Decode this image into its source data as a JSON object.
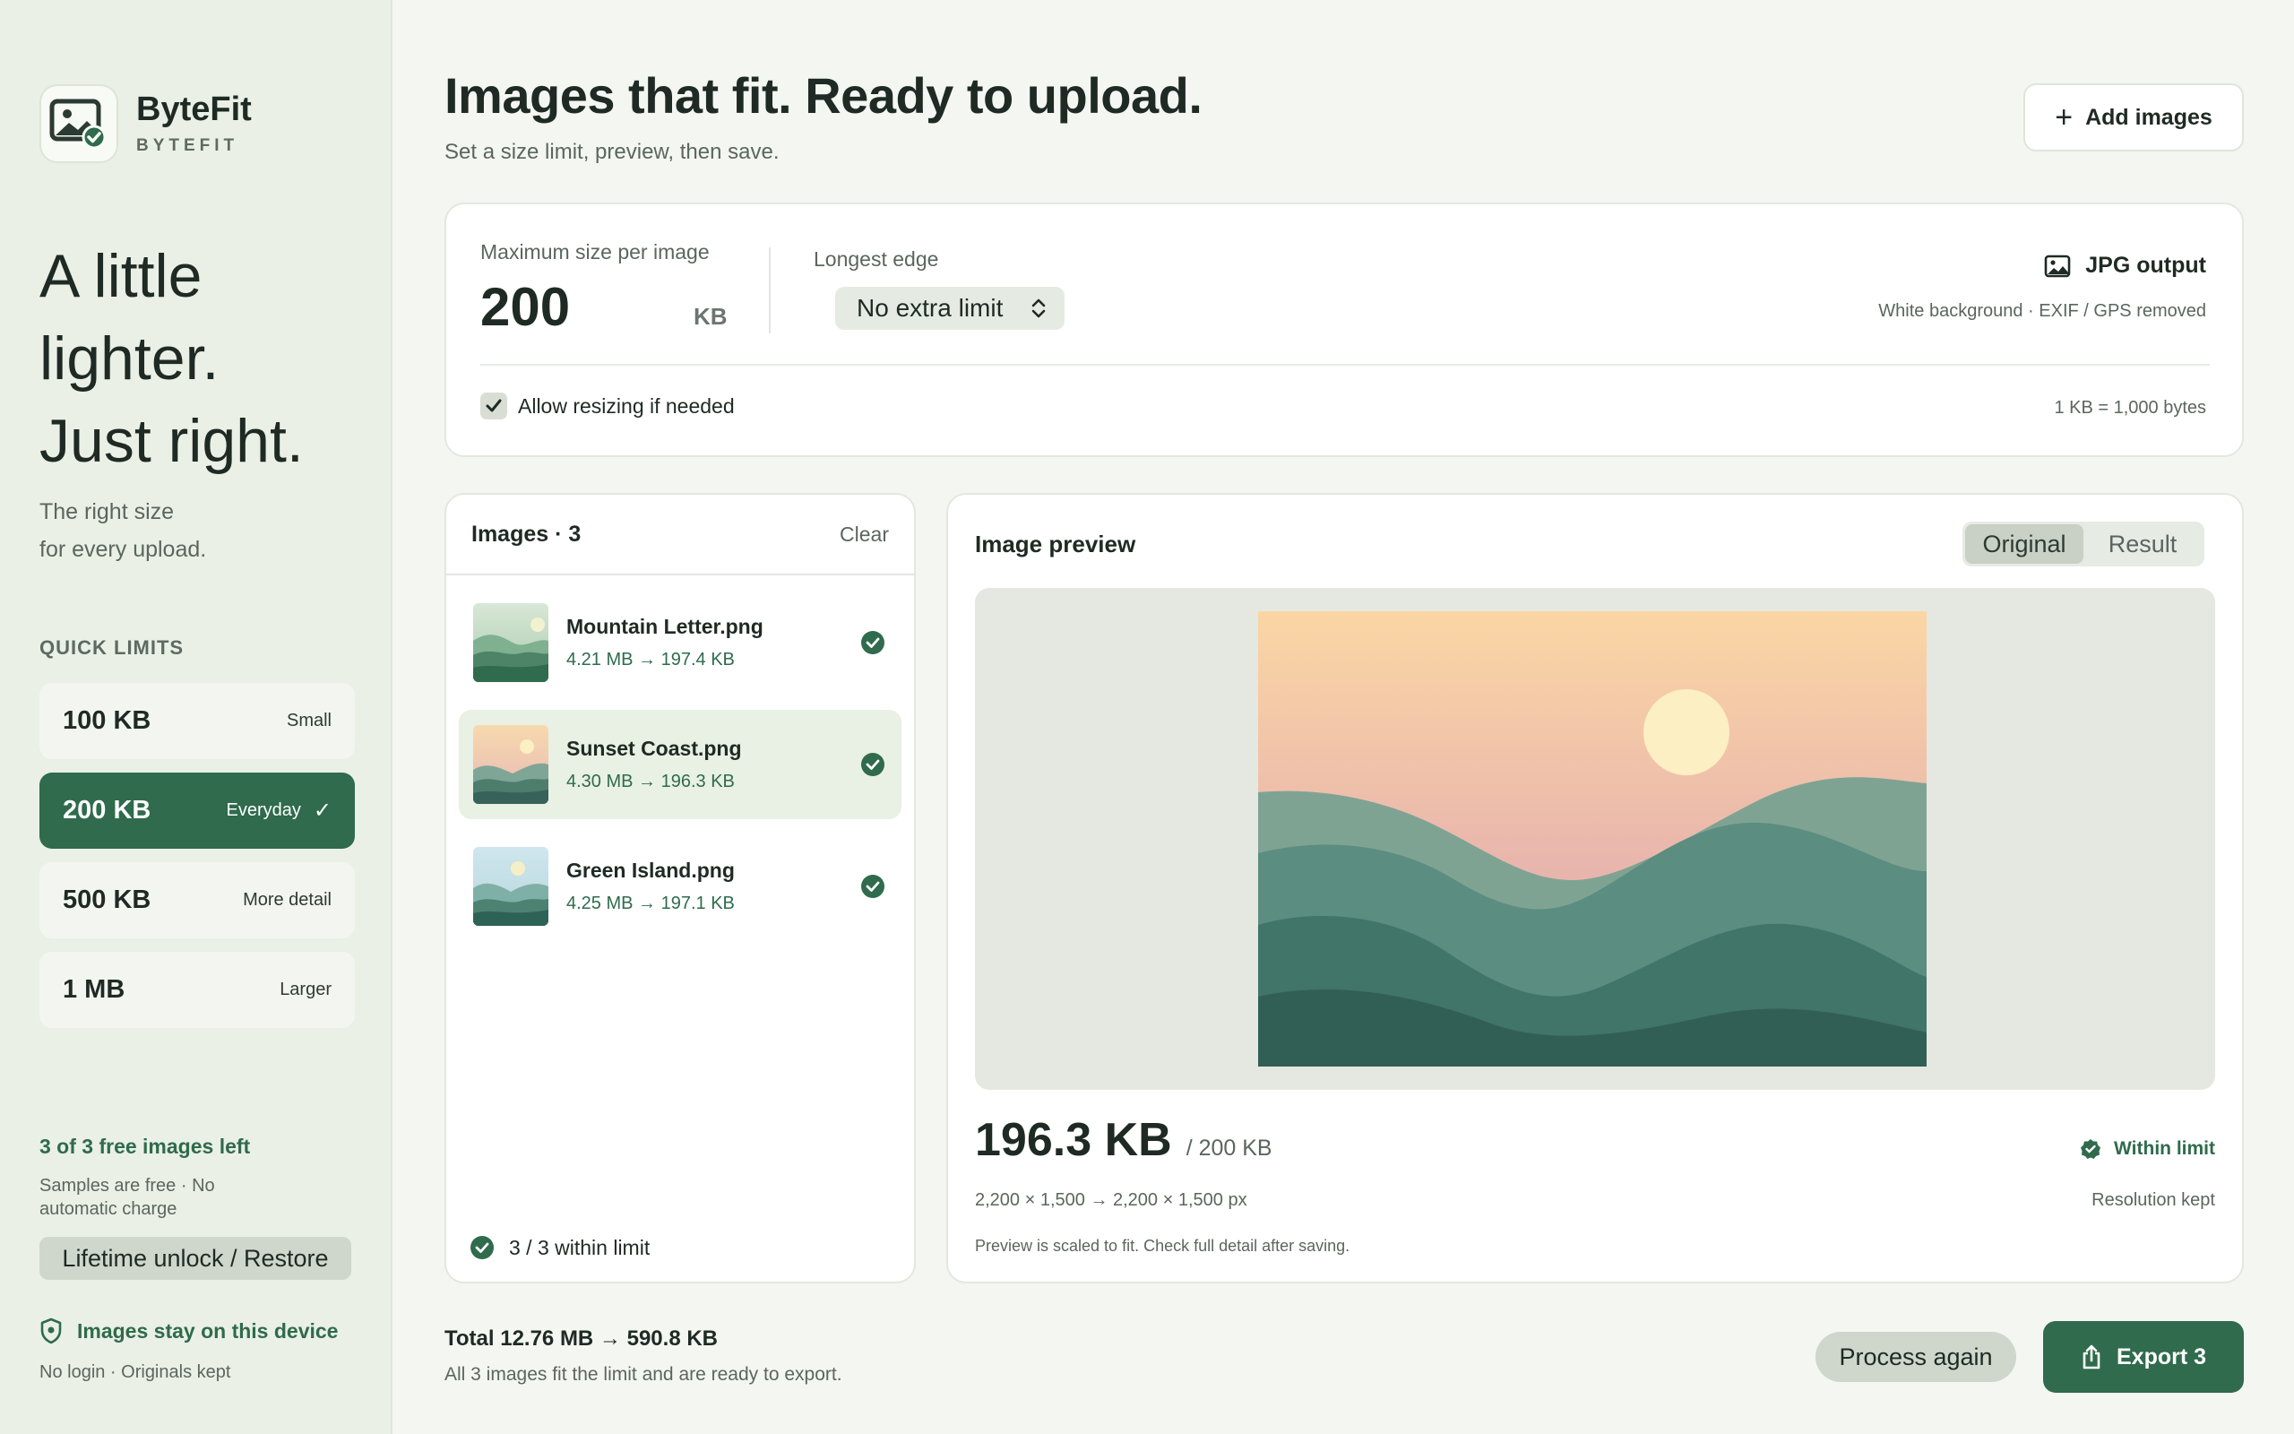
{
  "brand": {
    "name": "ByteFit",
    "sub": "BYTEFIT"
  },
  "sidebar": {
    "headline_line1": "A little",
    "headline_line2": "lighter.",
    "headline_line3": "Just right.",
    "subline_line1": "The right size",
    "subline_line2": "for every upload.",
    "quick_limits_label": "QUICK LIMITS",
    "quick_limits": [
      {
        "size": "100 KB",
        "tag": "Small"
      },
      {
        "size": "200 KB",
        "tag": "Everyday",
        "selected": true
      },
      {
        "size": "500 KB",
        "tag": "More detail"
      },
      {
        "size": "1 MB",
        "tag": "Larger"
      }
    ],
    "free_left": "3 of 3 free images left",
    "free_note": "Samples are free · No automatic charge",
    "unlock_label": "Lifetime unlock / Restore",
    "device_label": "Images stay on this device",
    "device_note": "No login · Originals kept"
  },
  "header": {
    "title": "Images that fit. Ready to upload.",
    "subtitle": "Set a size limit, preview, then save.",
    "add_label": "Add images"
  },
  "settings": {
    "max_label": "Maximum size per image",
    "max_value": "200",
    "max_unit": "KB",
    "edge_label": "Longest edge",
    "edge_value": "No extra limit",
    "output_label": "JPG output",
    "output_note": "White background · EXIF / GPS removed",
    "resize_label": "Allow resizing if needed",
    "resize_checked": true,
    "kb_note": "1 KB = 1,000 bytes"
  },
  "images": {
    "title": "Images · 3",
    "clear_label": "Clear",
    "items": [
      {
        "name": "Mountain Letter.png",
        "sizes": "4.21 MB → 197.4 KB"
      },
      {
        "name": "Sunset Coast.png",
        "sizes": "4.30 MB → 196.3 KB",
        "selected": true
      },
      {
        "name": "Green Island.png",
        "sizes": "4.25 MB → 197.1 KB"
      }
    ],
    "footer": "3 / 3 within limit"
  },
  "preview": {
    "title": "Image preview",
    "tab_original": "Original",
    "tab_result": "Result",
    "active_tab": "Original",
    "size": "196.3 KB",
    "limit": "/ 200 KB",
    "status": "Within limit",
    "dims": "2,200 × 1,500 → 2,200 × 1,500 px",
    "resolution": "Resolution kept",
    "note": "Preview is scaled to fit. Check full detail after saving."
  },
  "footer": {
    "total": "Total 12.76 MB → 590.8 KB",
    "total_note": "All 3 images fit the limit and are ready to export.",
    "process_label": "Process again",
    "export_label": "Export 3"
  },
  "colors": {
    "accent": "#2f6b4c",
    "background": "#f4f6f1",
    "sidebar": "#eaf0e6",
    "card": "#ffffff"
  }
}
